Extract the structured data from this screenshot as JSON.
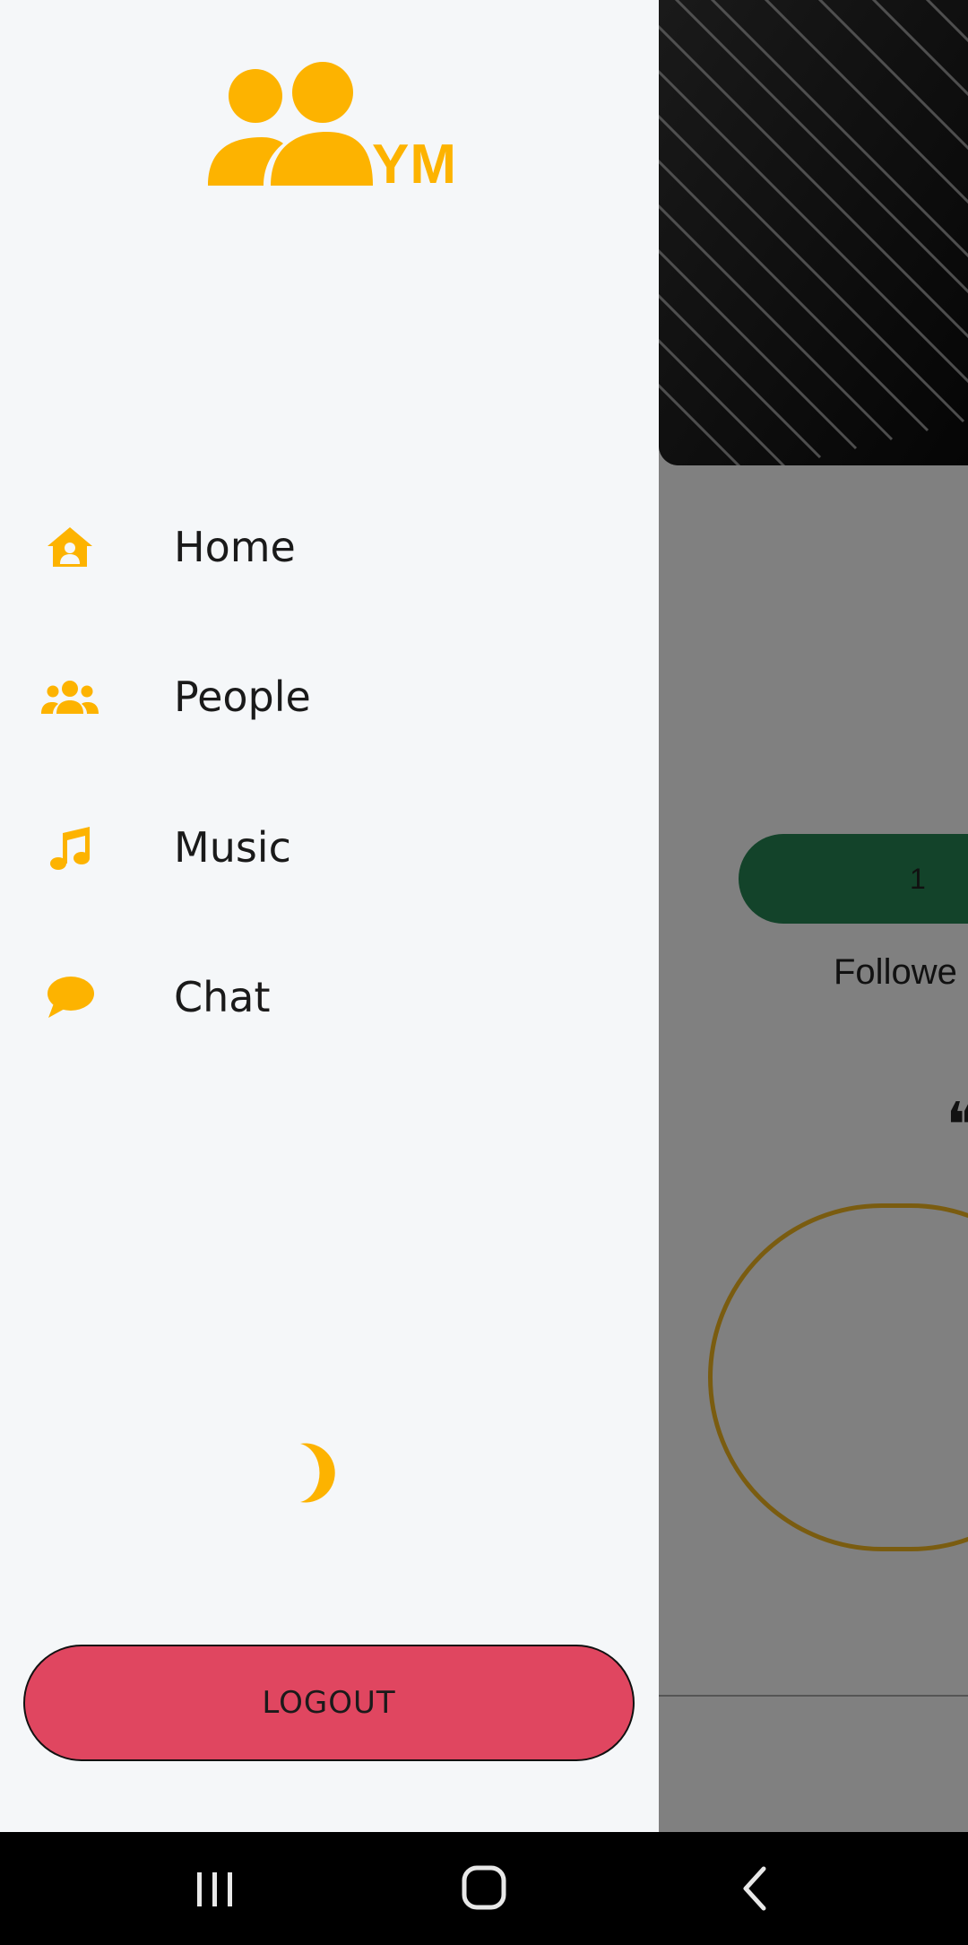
{
  "background": {
    "stat_value": "1",
    "stat_label": "Followe",
    "quote_glyph": "❝",
    "stat_pill_color": "#13432a"
  },
  "drawer": {
    "logo": {
      "icon": "people-logo-icon",
      "letters": "YM",
      "color": "#fdb300"
    },
    "items": [
      {
        "label": "Home",
        "icon": "home-person-icon"
      },
      {
        "label": "People",
        "icon": "group-icon"
      },
      {
        "label": "Music",
        "icon": "music-note-icon"
      },
      {
        "label": "Chat",
        "icon": "chat-bubble-icon"
      }
    ],
    "theme_toggle_icon": "moon-icon",
    "logout_label": "LOGOUT",
    "logout_color": "#e04660",
    "accent": "#fdb300"
  },
  "system_nav": {
    "buttons": [
      "recent-apps-icon",
      "home-icon",
      "back-icon"
    ]
  }
}
